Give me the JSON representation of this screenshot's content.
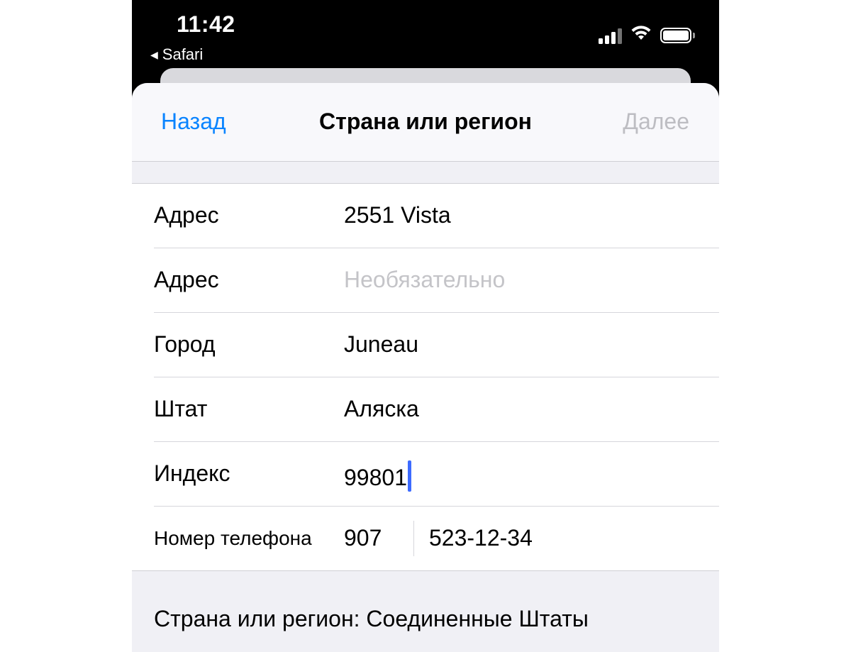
{
  "status_bar": {
    "time": "11:42",
    "back_app": "Safari",
    "back_app_icon": "back-triangle-icon",
    "signal_icon": "cellular-signal-icon",
    "wifi_icon": "wifi-icon",
    "battery_icon": "battery-icon"
  },
  "navbar": {
    "back_label": "Назад",
    "title": "Страна или регион",
    "next_label": "Далее",
    "accent_color": "#0a84ff",
    "disabled_color": "#bdbdc2"
  },
  "form": {
    "rows": [
      {
        "label": "Адрес",
        "value": "2551 Vista",
        "placeholder": ""
      },
      {
        "label": "Адрес",
        "value": "",
        "placeholder": "Необязательно"
      },
      {
        "label": "Город",
        "value": "Juneau",
        "placeholder": ""
      },
      {
        "label": "Штат",
        "value": "Аляска",
        "placeholder": ""
      },
      {
        "label": "Индекс",
        "value": "99801",
        "placeholder": ""
      }
    ],
    "phone": {
      "label": "Номер телефона",
      "area_code": "907",
      "number": "523-12-34"
    }
  },
  "footer": {
    "country": "Страна или регион: Соединенные Штаты"
  }
}
